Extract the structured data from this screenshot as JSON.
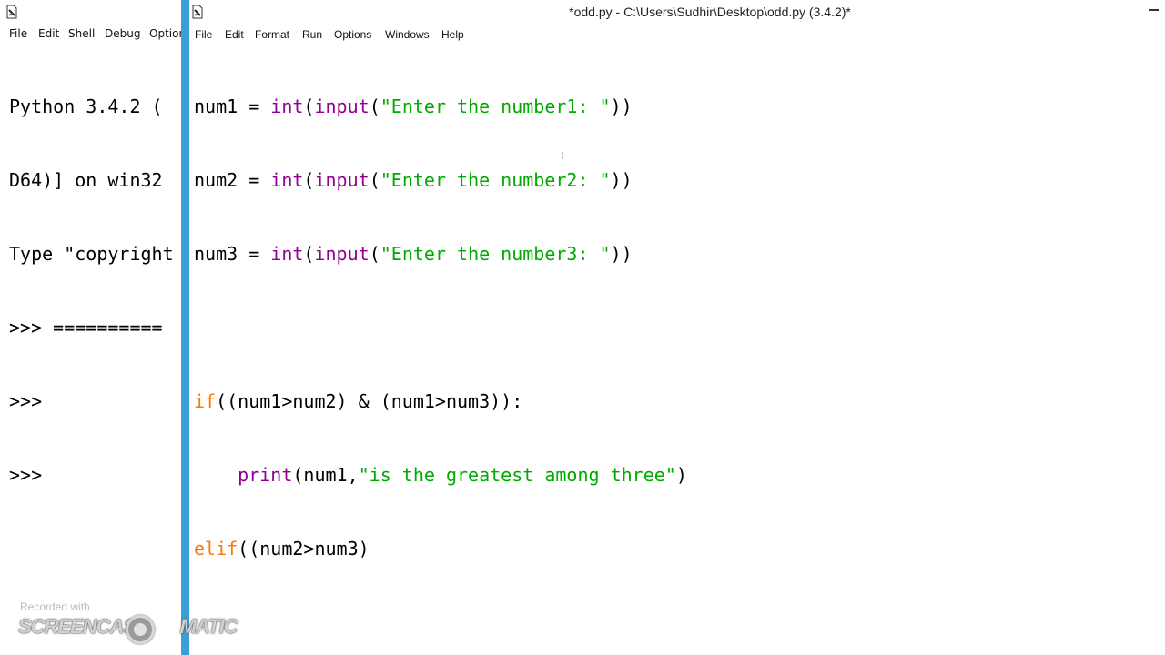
{
  "shell": {
    "menu": [
      "File",
      "Edit",
      "Shell",
      "Debug",
      "Options"
    ],
    "lines": [
      "Python 3.4.2 (",
      "D64)] on win32",
      "Type \"copyright",
      ">>> ==========",
      ">>> ",
      ">>> "
    ]
  },
  "editor": {
    "title": "*odd.py - C:\\Users\\Sudhir\\Desktop\\odd.py (3.4.2)*",
    "menu": [
      "File",
      "Edit",
      "Format",
      "Run",
      "Options",
      "Windows",
      "Help"
    ],
    "code": {
      "l1": {
        "a": "num1 = ",
        "b": "int",
        "c": "(",
        "d": "input",
        "e": "(",
        "f": "\"Enter the number1: \"",
        "g": "))"
      },
      "l2": {
        "a": "num2 = ",
        "b": "int",
        "c": "(",
        "d": "input",
        "e": "(",
        "f": "\"Enter the number2: \"",
        "g": "))"
      },
      "l3": {
        "a": "num3 = ",
        "b": "int",
        "c": "(",
        "d": "input",
        "e": "(",
        "f": "\"Enter the number3: \"",
        "g": "))"
      },
      "l5": {
        "kw": "if",
        "rest": "((num1>num2) & (num1>num3)):"
      },
      "l6": {
        "indent": "    ",
        "bi": "print",
        "a": "(num1,",
        "st": "\"is the greatest among three\"",
        "b": ")"
      },
      "l7": {
        "kw": "elif",
        "rest": "((num2>num3)"
      }
    }
  },
  "watermark": {
    "recorded": "Recorded with",
    "brand_left": "SCREENCAST",
    "brand_right": "MATIC"
  },
  "colors": {
    "keyword": "#ff7700",
    "builtin": "#900090",
    "string": "#00aa00",
    "taskbar_strip": "#3a9fd6"
  }
}
